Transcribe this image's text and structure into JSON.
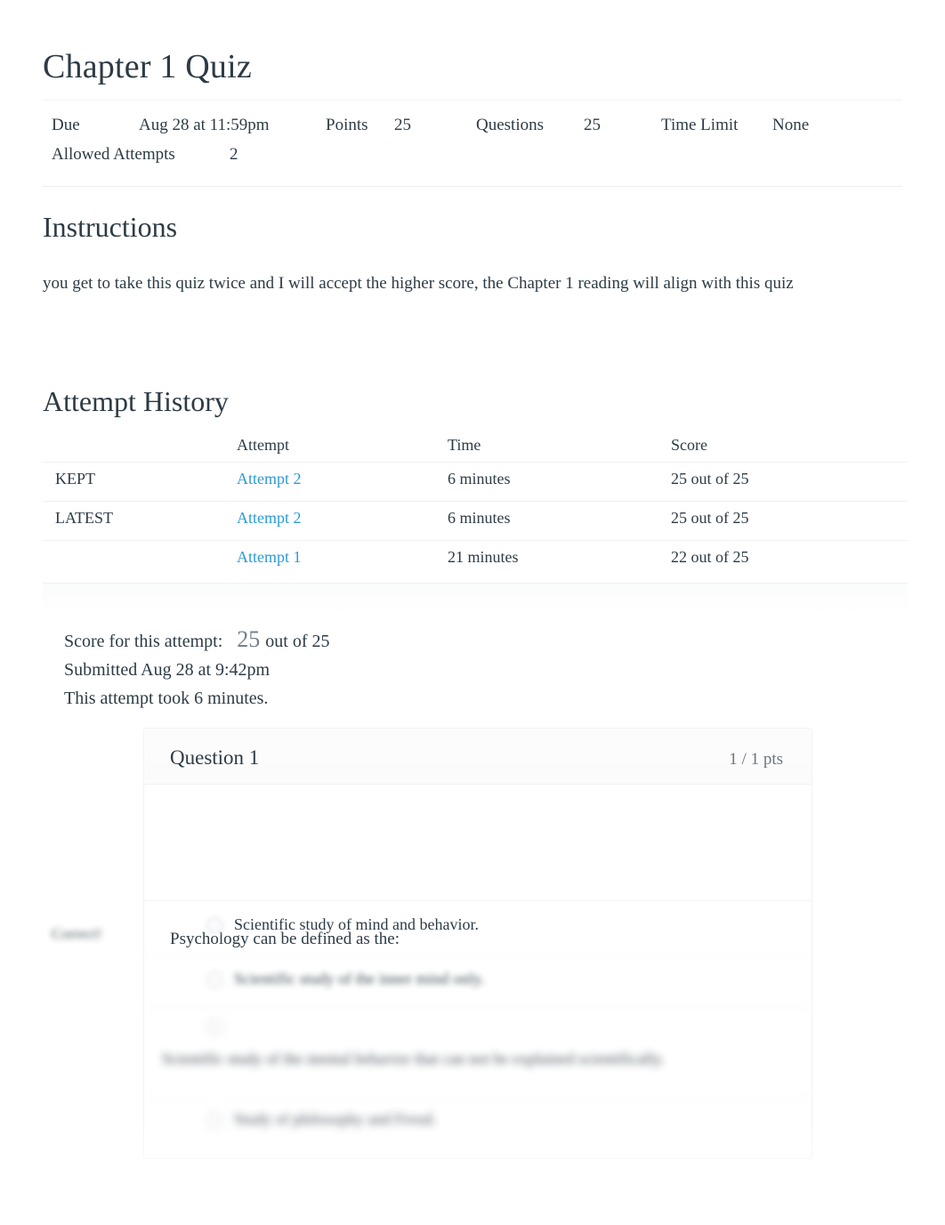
{
  "quiz": {
    "title": "Chapter 1 Quiz",
    "details": {
      "due_label": "Due",
      "due_value": "Aug 28 at 11:59pm",
      "points_label": "Points",
      "points_value": "25",
      "questions_label": "Questions",
      "questions_value": "25",
      "time_limit_label": "Time Limit",
      "time_limit_value": "None",
      "allowed_attempts_label": "Allowed Attempts",
      "allowed_attempts_value": "2"
    }
  },
  "instructions": {
    "heading": "Instructions",
    "body": "you get to take this quiz twice and I will accept the higher score, the Chapter 1 reading will align with this quiz"
  },
  "attempt_history": {
    "heading": "Attempt History",
    "columns": [
      "",
      "Attempt",
      "Time",
      "Score"
    ],
    "rows": [
      {
        "kind": "KEPT",
        "attempt": "Attempt 2",
        "time": "6 minutes",
        "score": "25 out of 25"
      },
      {
        "kind": "LATEST",
        "attempt": "Attempt 2",
        "time": "6 minutes",
        "score": "25 out of 25"
      },
      {
        "kind": "",
        "attempt": "Attempt 1",
        "time": "21 minutes",
        "score": "22 out of 25"
      }
    ]
  },
  "attempt_summary": {
    "score_label": "Score for this attempt:",
    "score_value": "25",
    "score_out_of": "out of 25",
    "submitted": "Submitted Aug 28 at 9:42pm",
    "duration": "This attempt took 6 minutes."
  },
  "question": {
    "name": "Question 1",
    "points": "1 / 1 pts",
    "prompt": "Psychology can be defined as the:",
    "correct_tag": "Correct!",
    "answers": [
      {
        "text": "Scientific study of mind and behavior.",
        "blur": "none"
      },
      {
        "text": "Scientific study of the inner mind only.",
        "blur": "heavy"
      },
      {
        "text": "Scientific study of the mental behavior that can not be explained scientifically.",
        "blur": "heavy"
      },
      {
        "text": "Study of philosophy and Freud.",
        "blur": "heavy"
      }
    ]
  },
  "colors": {
    "link": "#2b9ad6",
    "text": "#2d3b45",
    "muted": "#73818c",
    "border": "#f1f2f3"
  }
}
